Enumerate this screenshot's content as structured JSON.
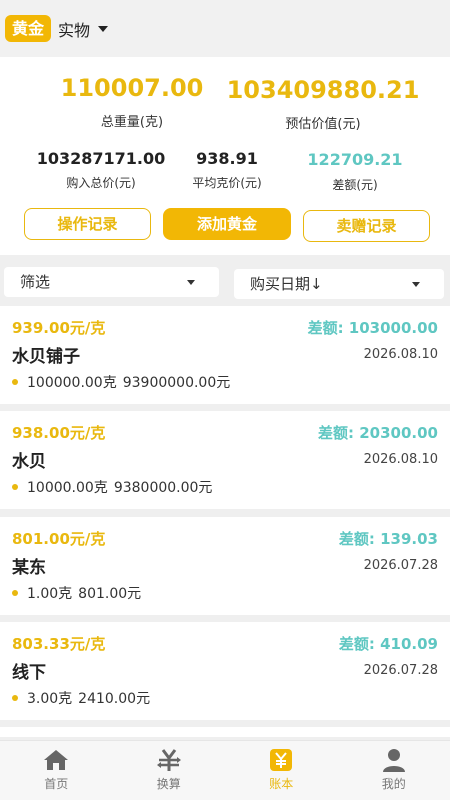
{
  "header": {
    "gold_tag": "黄金",
    "kind": "实物"
  },
  "summary": {
    "total_weight": "110007.00",
    "total_weight_label": "总重量(克)",
    "estimated_value": "103409880.21",
    "estimated_value_label": "预估价值(元)",
    "purchase_total": "103287171.00",
    "purchase_total_label": "购入总价(元)",
    "avg_price": "938.91",
    "avg_price_label": "平均克价(元)",
    "difference": "122709.21",
    "difference_label": "差额(元)"
  },
  "actions": {
    "records": "操作记录",
    "add_gold": "添加黄金",
    "sell_records": "卖赠记录"
  },
  "filters": {
    "filter_label": "筛选",
    "sort_label": "购买日期↓"
  },
  "list": [
    {
      "price": "939.00元/克",
      "diff": "差额: 103000.00",
      "name": "水贝铺子",
      "date": "2026.08.10",
      "weight": "100000.00克",
      "amount": "93900000.00元"
    },
    {
      "price": "938.00元/克",
      "diff": "差额: 20300.00",
      "name": "水贝",
      "date": "2026.08.10",
      "weight": "10000.00克",
      "amount": "9380000.00元"
    },
    {
      "price": "801.00元/克",
      "diff": "差额: 139.03",
      "name": "某东",
      "date": "2026.07.28",
      "weight": "1.00克",
      "amount": "801.00元"
    },
    {
      "price": "803.33元/克",
      "diff": "差额: 410.09",
      "name": "线下",
      "date": "2026.07.28",
      "weight": "3.00克",
      "amount": "2410.00元"
    }
  ],
  "nav": [
    {
      "label": "首页",
      "icon": "home-icon"
    },
    {
      "label": "换算",
      "icon": "yuan-convert-icon"
    },
    {
      "label": "账本",
      "icon": "ledger-icon"
    },
    {
      "label": "我的",
      "icon": "user-icon"
    }
  ],
  "colors": {
    "accent": "#f2b705",
    "gold_text": "#e9b80f",
    "diff_text": "#5fc7c2"
  }
}
